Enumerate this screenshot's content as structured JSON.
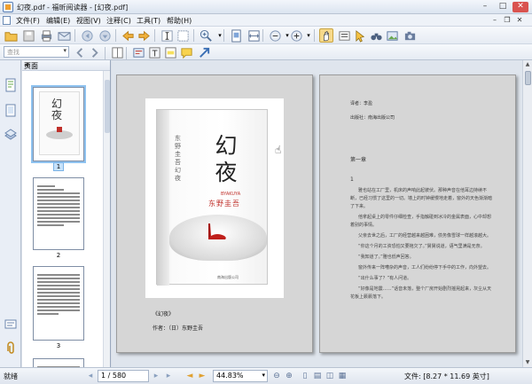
{
  "window": {
    "title": "幻夜.pdf - 福昕阅读器 - [幻夜.pdf]",
    "minimize": "–",
    "maximize": "□",
    "close": "✕"
  },
  "menu": {
    "items": [
      "文件(F)",
      "编辑(E)",
      "视图(V)",
      "注释(C)",
      "工具(T)",
      "帮助(H)"
    ],
    "mdi_minimize": "–",
    "mdi_restore": "❐",
    "mdi_close": "✕"
  },
  "toolbar": {
    "search_placeholder": "查找"
  },
  "side_panel": {
    "header": "页面",
    "collapse": "◀",
    "thumbnails": [
      {
        "label": "1",
        "selected": true
      },
      {
        "label": "2",
        "selected": false
      },
      {
        "label": "3",
        "selected": false
      }
    ]
  },
  "document": {
    "cover": {
      "title": "幻夜",
      "subtitle": "BYAKUYA",
      "author": "东野圭吾",
      "spine": "东野圭吾幻夜",
      "publisher": "南海出版公司"
    },
    "left_caption": {
      "book": "《幻夜》",
      "author": "作者：（日）东野圭吾"
    },
    "right_page": {
      "translator": "译者：李盈",
      "publisher": "出版社：南海出版公司",
      "heading": "第一章",
      "number": "1",
      "paragraphs": [
        "雅也站在工厂里，机床的声响此起彼伏。那种声音在他耳边持续不断，已经习惯了这里的一切。墙上的时钟缓慢地走着，窗外的天色渐渐暗了下来。",
        "他拿起桌上的零件仔细检查，手指触碰到冰冷的金属表面，心中却想着别的事情。",
        "父亲去世之后，工厂的经营越来越困难，债务像雪球一样越滚越大。",
        "“你这个月的工资恐怕又要拖欠了。”舅舅说道，语气里满是无奈。",
        "“我知道了。”雅也低声回答。",
        "窗外传来一阵嘈杂的声音，工人们纷纷停下手中的工作，向外望去。",
        "“出什么事了？”有人问道。",
        "“好像是地震……”话音未落，整个厂房开始剧烈摇晃起来，灰尘从天花板上簌簌落下。"
      ]
    }
  },
  "status": {
    "ready": "就绪",
    "page_display": "1 / 580",
    "zoom": "44.83%",
    "file_size": "文件: [8.27 * 11.69 英寸]"
  },
  "colors": {
    "accent": "#3a6fb5",
    "selection": "#8fc3f0"
  }
}
